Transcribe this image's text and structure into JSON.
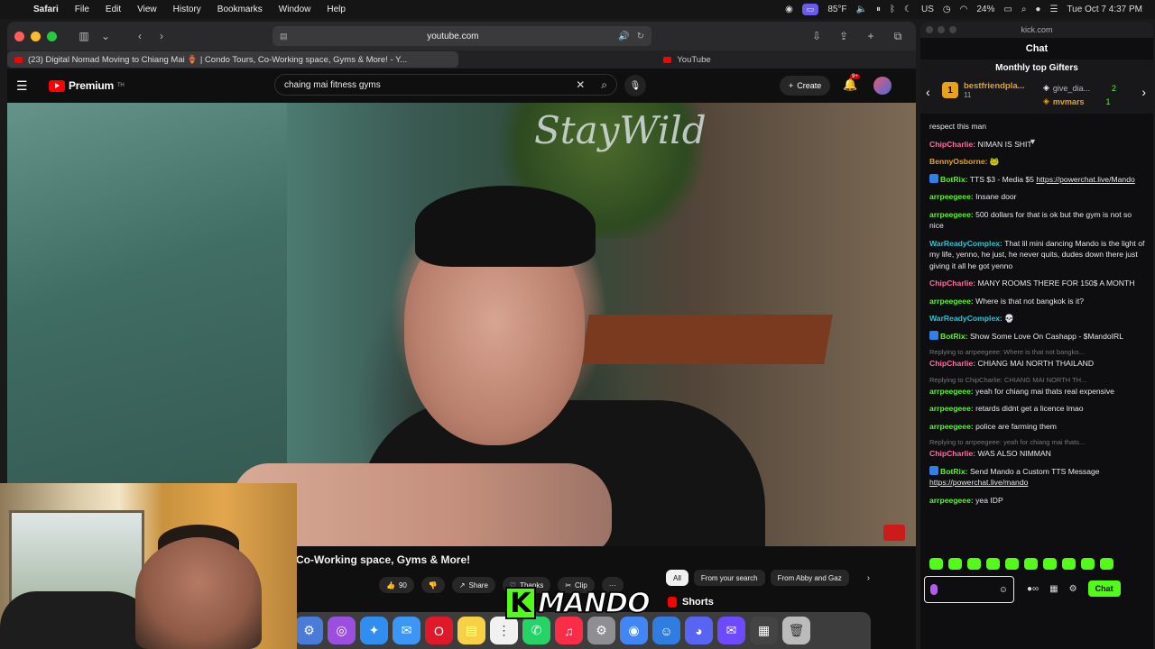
{
  "menubar": {
    "app": "Safari",
    "items": [
      "File",
      "Edit",
      "View",
      "History",
      "Bookmarks",
      "Window",
      "Help"
    ],
    "temperature": "85°F",
    "keyboard": "US",
    "battery": "24%",
    "datetime": "Tue Oct 7  4:37 PM"
  },
  "browser": {
    "url": "youtube.com",
    "tab_active": "(23) Digital Nomad Moving to Chiang Mai 🏺 | Condo Tours, Co-Working space, Gyms & More! - Y...",
    "tab_second": "YouTube"
  },
  "youtube": {
    "logo": "Premium",
    "logo_sup": "TH",
    "search_query": "chaing mai fitness gyms",
    "create_label": "Create",
    "notif_count": "9+",
    "video_sign_text": "StayWild",
    "video_title": "Co-Working space, Gyms & More!",
    "like_count": "90",
    "share_label": "Share",
    "thanks_label": "Thanks",
    "clip_label": "Clip",
    "chips": [
      "All",
      "From your search",
      "From Abby and Gaz"
    ],
    "shorts_label": "Shorts"
  },
  "overlay": {
    "logo_k": "K",
    "logo_word": "MANDO"
  },
  "dock": {
    "icons": [
      "settings-icon",
      "podcasts-icon",
      "safari-icon",
      "mail-icon",
      "opera-icon",
      "notes-icon",
      "reminders-icon",
      "whatsapp-icon",
      "music-icon",
      "system-settings-icon",
      "chrome-icon",
      "finder-icon",
      "discord-icon",
      "proton-mail-icon",
      "photos-icon",
      "trash-icon"
    ]
  },
  "kick": {
    "window_url": "kick.com",
    "title": "Chat",
    "gifters_heading": "Monthly top Gifters",
    "gifter1": {
      "name": "bestfriendpla...",
      "count": "11",
      "rank": "1"
    },
    "gifter2": {
      "name": "give_dia...",
      "count": "2"
    },
    "gifter3": {
      "name": "mvmars",
      "count": "1"
    },
    "messages": [
      {
        "user": "",
        "color": "#e8e8e8",
        "text": "respect this man"
      },
      {
        "user": "ChipCharlie:",
        "color": "#ff6b9d",
        "text": "NIMAN IS SHIT"
      },
      {
        "user": "BennyOsborne:",
        "color": "#e8a21a",
        "text": "🐸"
      },
      {
        "user": "BotRix:",
        "color": "#53fc18",
        "text": "TTS $3 - Media $5",
        "link": "https://powerchat.live/Mando"
      },
      {
        "user": "arrpeegeee:",
        "color": "#53fc18",
        "text": "Insane door"
      },
      {
        "user": "arrpeegeee:",
        "color": "#53fc18",
        "text": "500 dollars for that is ok but the gym is not so nice"
      },
      {
        "user": "WarReadyComplex:",
        "color": "#20c7d8",
        "text": "That lil mini dancing Mando is the light of my life, yenno, he just, he never quits, dudes down there just giving it all he got yenno"
      },
      {
        "user": "ChipCharlie:",
        "color": "#ff6b9d",
        "text": "MANY ROOMS THERE FOR 150$ A MONTH"
      },
      {
        "user": "arrpeegeee:",
        "color": "#53fc18",
        "text": "Where is that not bangkok is it?"
      },
      {
        "user": "WarReadyComplex:",
        "color": "#20c7d8",
        "text": "💀"
      },
      {
        "user": "BotRix:",
        "color": "#53fc18",
        "text": "Show Some Love On Cashapp - $MandoIRL"
      },
      {
        "user": "ChipCharlie:",
        "color": "#ff6b9d",
        "text": "CHIANG MAI NORTH THAILAND",
        "reply": "Replying to arrpeegeee: Where is that not bangko..."
      },
      {
        "user": "arrpeegeee:",
        "color": "#53fc18",
        "text": "yeah for chiang mai thats real expensive",
        "reply": "Replying to ChipCharlie: CHIANG MAI NORTH TH..."
      },
      {
        "user": "arrpeegeee:",
        "color": "#53fc18",
        "text": "retards didnt get a licence lmao"
      },
      {
        "user": "arrpeegeee:",
        "color": "#53fc18",
        "text": "police are farming them"
      },
      {
        "user": "ChipCharlie:",
        "color": "#ff6b9d",
        "text": "WAS ALSO NIMMAN",
        "reply": "Replying to arrpeegeee: yeah for chiang mai thats..."
      },
      {
        "user": "BotRix:",
        "color": "#53fc18",
        "text": "Send Mando a Custom TTS Message",
        "link": "https://powerchat.live/mando"
      },
      {
        "user": "arrpeegeee:",
        "color": "#53fc18",
        "text": "yea IDP"
      }
    ],
    "chat_button": "Chat"
  }
}
